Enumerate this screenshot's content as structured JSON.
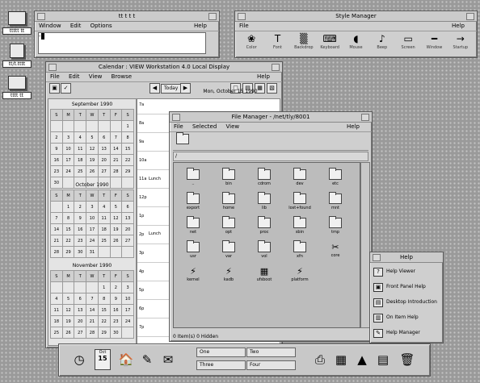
{
  "desktop_icons": [
    {
      "name": "desktop-icon-1",
      "label": "ttttt tt"
    },
    {
      "name": "desktop-icon-2",
      "label": "tt/t.tttt"
    },
    {
      "name": "desktop-icon-3",
      "label": "tttt tt"
    }
  ],
  "terminal": {
    "title": "tt t t t",
    "menu": {
      "window": "Window",
      "edit": "Edit",
      "options": "Options",
      "help": "Help"
    },
    "prompt": "-"
  },
  "style_manager": {
    "title": "Style Manager",
    "menu": {
      "file": "File",
      "help": "Help"
    },
    "items": [
      {
        "label": "Color",
        "icon": "color-icon",
        "glyph": "❀"
      },
      {
        "label": "Font",
        "icon": "font-icon",
        "glyph": "T"
      },
      {
        "label": "Backdrop",
        "icon": "backdrop-icon",
        "glyph": "▒"
      },
      {
        "label": "Keyboard",
        "icon": "keyboard-icon",
        "glyph": "⌨"
      },
      {
        "label": "Mouse",
        "icon": "mouse-icon",
        "glyph": "◖"
      },
      {
        "label": "Beep",
        "icon": "beep-icon",
        "glyph": "♪"
      },
      {
        "label": "Screen",
        "icon": "screen-icon",
        "glyph": "▭"
      },
      {
        "label": "Window",
        "icon": "window-icon",
        "glyph": "━"
      },
      {
        "label": "Startup",
        "icon": "startup-icon",
        "glyph": "→"
      }
    ]
  },
  "calendar": {
    "title": "Calendar : VIEW Workstation 4.0 Local Display",
    "menu": {
      "file": "File",
      "edit": "Edit",
      "view": "View",
      "browse": "Browse",
      "help": "Help"
    },
    "today_label": "Today",
    "day_title": "Mon, October 15 1990",
    "months": [
      {
        "title": "September 1990",
        "days_header": [
          "S",
          "M",
          "T",
          "W",
          "T",
          "F",
          "S"
        ],
        "rows": [
          [
            "",
            "",
            "",
            "",
            "",
            "",
            "1"
          ],
          [
            "2",
            "3",
            "4",
            "5",
            "6",
            "7",
            "8"
          ],
          [
            "9",
            "10",
            "11",
            "12",
            "13",
            "14",
            "15"
          ],
          [
            "16",
            "17",
            "18",
            "19",
            "20",
            "21",
            "22"
          ],
          [
            "23",
            "24",
            "25",
            "26",
            "27",
            "28",
            "29"
          ],
          [
            "30",
            "",
            "",
            "",
            "",
            "",
            ""
          ]
        ]
      },
      {
        "title": "October 1990",
        "days_header": [
          "S",
          "M",
          "T",
          "W",
          "T",
          "F",
          "S"
        ],
        "rows": [
          [
            "",
            "1",
            "2",
            "3",
            "4",
            "5",
            "6"
          ],
          [
            "7",
            "8",
            "9",
            "10",
            "11",
            "12",
            "13"
          ],
          [
            "14",
            "15",
            "16",
            "17",
            "18",
            "19",
            "20"
          ],
          [
            "21",
            "22",
            "23",
            "24",
            "25",
            "26",
            "27"
          ],
          [
            "28",
            "29",
            "30",
            "31",
            "",
            "",
            ""
          ]
        ]
      },
      {
        "title": "November 1990",
        "days_header": [
          "S",
          "M",
          "T",
          "W",
          "T",
          "F",
          "S"
        ],
        "rows": [
          [
            "",
            "",
            "",
            "",
            "1",
            "2",
            "3"
          ],
          [
            "4",
            "5",
            "6",
            "7",
            "8",
            "9",
            "10"
          ],
          [
            "11",
            "12",
            "13",
            "14",
            "15",
            "16",
            "17"
          ],
          [
            "18",
            "19",
            "20",
            "21",
            "22",
            "23",
            "24"
          ],
          [
            "25",
            "26",
            "27",
            "28",
            "29",
            "30",
            ""
          ]
        ]
      }
    ],
    "hours": [
      "7a",
      "8a",
      "9a",
      "10a",
      "11a",
      "12p",
      "1p",
      "2p",
      "3p",
      "4p",
      "5p",
      "6p",
      "7p"
    ],
    "appt_1": "Lunch",
    "appt_2": "Lunch"
  },
  "file_manager": {
    "title": "File Manager - /net/tly/8001",
    "menu": {
      "file": "File",
      "selected": "Selected",
      "view": "View",
      "help": "Help"
    },
    "path": "/",
    "items": [
      {
        "name": "..",
        "type": "folder"
      },
      {
        "name": "bin",
        "type": "folder"
      },
      {
        "name": "cdrom",
        "type": "folder"
      },
      {
        "name": "dev",
        "type": "folder"
      },
      {
        "name": "etc",
        "type": "folder"
      },
      {
        "name": "export",
        "type": "folder"
      },
      {
        "name": "home",
        "type": "folder"
      },
      {
        "name": "lib",
        "type": "folder"
      },
      {
        "name": "lost+found",
        "type": "folder"
      },
      {
        "name": "mnt",
        "type": "folder"
      },
      {
        "name": "net",
        "type": "folder"
      },
      {
        "name": "opt",
        "type": "folder"
      },
      {
        "name": "proc",
        "type": "folder"
      },
      {
        "name": "sbin",
        "type": "folder"
      },
      {
        "name": "tmp",
        "type": "folder"
      },
      {
        "name": "usr",
        "type": "folder"
      },
      {
        "name": "var",
        "type": "folder"
      },
      {
        "name": "vol",
        "type": "folder"
      },
      {
        "name": "xfn",
        "type": "folder"
      },
      {
        "name": "core",
        "type": "file",
        "glyph": "✂"
      },
      {
        "name": "kernel",
        "type": "file",
        "glyph": "⚡"
      },
      {
        "name": "kadb",
        "type": "file",
        "glyph": "⚡"
      },
      {
        "name": "ufsboot",
        "type": "file",
        "glyph": "▦"
      },
      {
        "name": "platform",
        "type": "file",
        "glyph": "⚡"
      }
    ],
    "status": "0 Item(s) 0 Hidden"
  },
  "help_panel": {
    "title": "Help",
    "items": [
      {
        "label": "Help Viewer",
        "icon": "help-viewer-icon",
        "glyph": "?"
      },
      {
        "label": "Front Panel Help",
        "icon": "front-panel-help-icon",
        "glyph": "▣"
      },
      {
        "label": "Desktop Introduction",
        "icon": "desktop-intro-icon",
        "glyph": "▤"
      },
      {
        "label": "On Item Help",
        "icon": "on-item-help-icon",
        "glyph": "▥"
      },
      {
        "label": "Help Manager",
        "icon": "help-manager-icon",
        "glyph": "✎"
      }
    ]
  },
  "front_panel": {
    "clock": "clock",
    "calendar_day": "Oct",
    "calendar_date": "15",
    "workspaces": [
      "One",
      "Two",
      "Three",
      "Four"
    ],
    "icons": [
      "home-folder",
      "text-editor",
      "mailer",
      "printer",
      "style-manager",
      "application-manager",
      "help",
      "trash"
    ]
  }
}
